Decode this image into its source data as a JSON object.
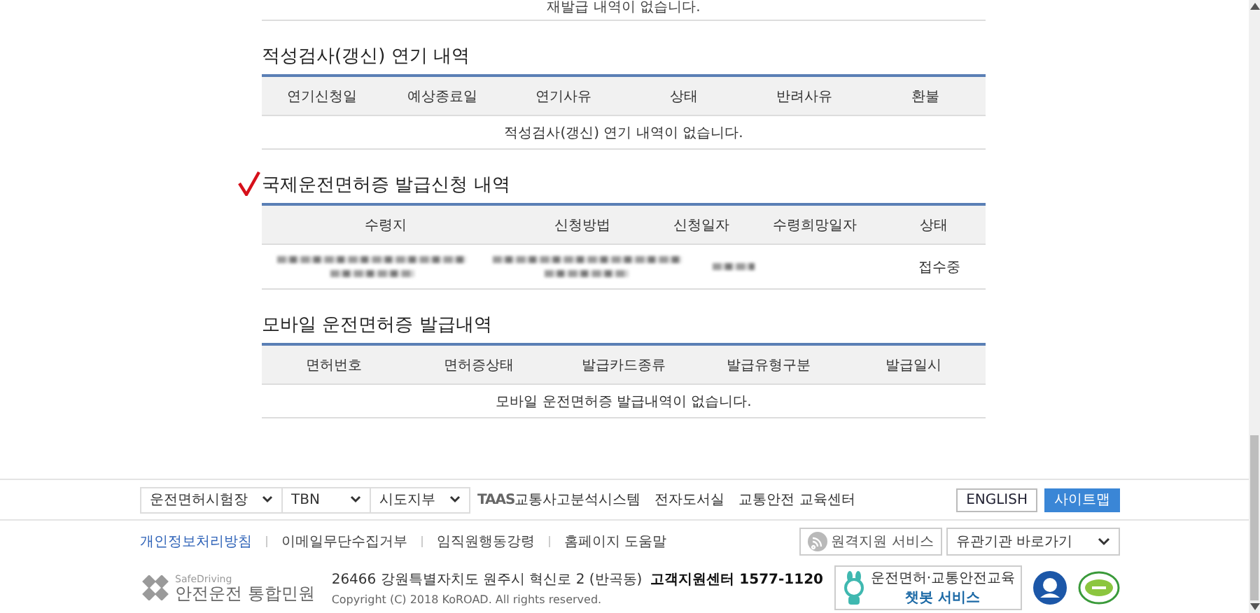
{
  "top_notice": "재발급 내역이 없습니다.",
  "sections": [
    {
      "title": "적성검사(갱신) 연기 내역",
      "marked": false,
      "columns": [
        "연기신청일",
        "예상종료일",
        "연기사유",
        "상태",
        "반려사유",
        "환불"
      ],
      "empty_message": "적성검사(갱신) 연기 내역이 없습니다."
    },
    {
      "title": "국제운전면허증 발급신청 내역",
      "marked": true,
      "columns": [
        "수령지",
        "신청방법",
        "신청일자",
        "수령희망일자",
        "상태"
      ],
      "rows": [
        [
          {
            "kind": "redacted"
          },
          {
            "kind": "redacted"
          },
          {
            "kind": "redacted_short"
          },
          {
            "kind": "empty"
          },
          {
            "kind": "text",
            "text": "접수중"
          }
        ]
      ]
    },
    {
      "title": "모바일 운전면허증 발급내역",
      "marked": false,
      "columns": [
        "면허번호",
        "면허증상태",
        "발급카드종류",
        "발급유형구분",
        "발급일시"
      ],
      "empty_message": "모바일 운전면허증 발급내역이 없습니다."
    }
  ],
  "footer": {
    "selects": [
      "운전면허시험장",
      "TBN",
      "시도지부"
    ],
    "links": [
      {
        "kind": "taas",
        "logo": "TAAS",
        "text": "교통사고분석시스템"
      },
      {
        "kind": "plain",
        "text": "전자도서실"
      },
      {
        "kind": "plain",
        "text": "교통안전 교육센터"
      }
    ],
    "buttons": [
      {
        "label": "ENGLISH",
        "primary": false
      },
      {
        "label": "사이트맵",
        "primary": true
      }
    ],
    "policy_links": [
      {
        "text": "개인정보처리방침",
        "highlighted": true
      },
      {
        "text": "이메일무단수집거부",
        "highlighted": false
      },
      {
        "text": "임직원행동강령",
        "highlighted": false
      },
      {
        "text": "홈페이지 도움말",
        "highlighted": false
      }
    ],
    "remote_support": "원격지원 서비스",
    "related_sites": "유관기관 바로가기",
    "logo": {
      "small": "SafeDriving",
      "name": "안전운전 통합민원"
    },
    "address": "26466 강원특별자치도 원주시 혁신로 2 (반곡동)",
    "call_center": "고객지원센터 1577-1120",
    "copyright": "Copyright (C) 2018 KoROAD. All rights reserved.",
    "chatbot": {
      "line1": "운전면허·교통안전교육",
      "line2": "챗봇 서비스"
    }
  }
}
